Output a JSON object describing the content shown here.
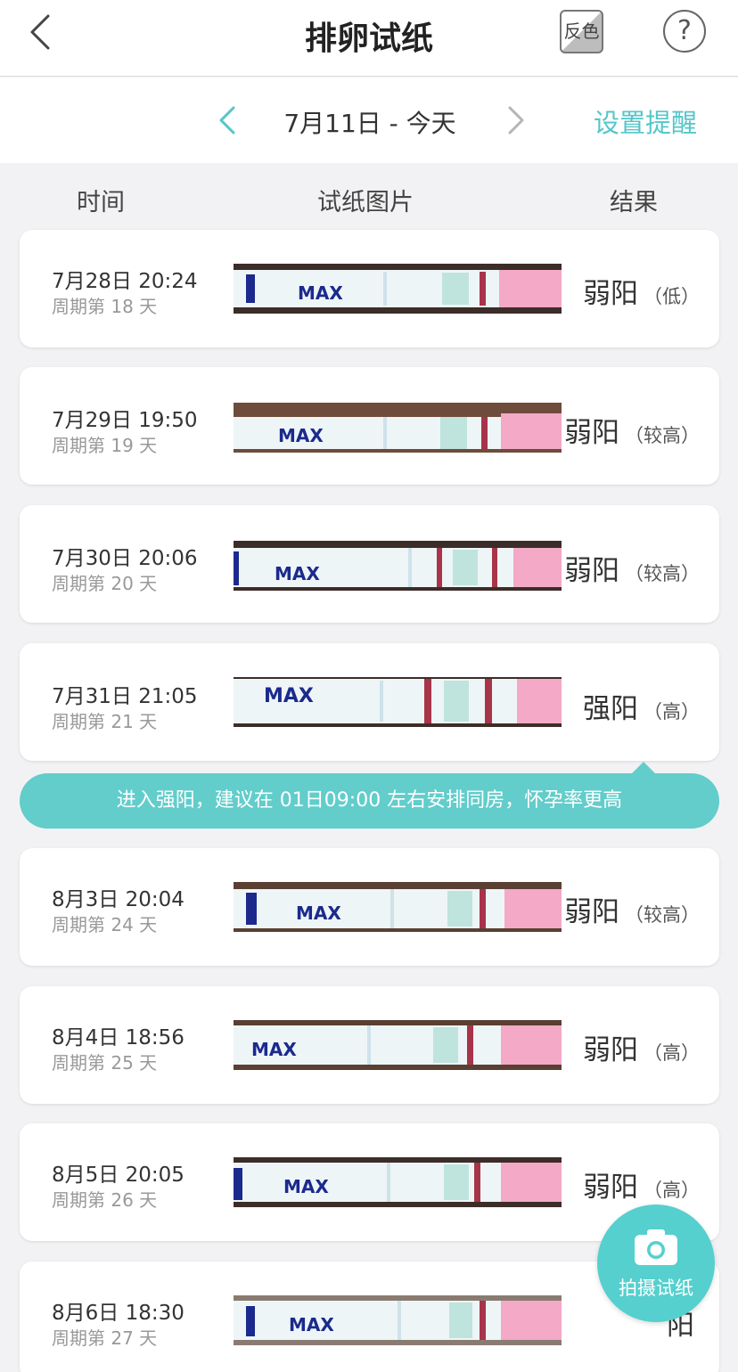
{
  "nav": {
    "title": "排卵试纸",
    "invert_label": "反色",
    "help_label": "?"
  },
  "date_bar": {
    "range": "7月11日 - 今天",
    "reminder": "设置提醒"
  },
  "columns": {
    "time": "时间",
    "picture": "试纸图片",
    "result": "结果"
  },
  "records": [
    {
      "datetime": "7月28日 20:24",
      "cycle": "周期第 18 天",
      "result": "弱阳",
      "level": "（低）",
      "strip_label": "MAX"
    },
    {
      "datetime": "7月29日 19:50",
      "cycle": "周期第 19 天",
      "result": "弱阳",
      "level": "（较高）",
      "strip_label": "MAX"
    },
    {
      "datetime": "7月30日 20:06",
      "cycle": "周期第 20 天",
      "result": "弱阳",
      "level": "（较高）",
      "strip_label": "MAX"
    },
    {
      "datetime": "7月31日 21:05",
      "cycle": "周期第 21 天",
      "result": "强阳",
      "level": "（高）",
      "strip_label": "MAX"
    },
    {
      "datetime": "8月3日 20:04",
      "cycle": "周期第 24 天",
      "result": "弱阳",
      "level": "（较高）",
      "strip_label": "MAX"
    },
    {
      "datetime": "8月4日 18:56",
      "cycle": "周期第 25 天",
      "result": "弱阳",
      "level": "（高）",
      "strip_label": "MAX"
    },
    {
      "datetime": "8月5日 20:05",
      "cycle": "周期第 26 天",
      "result": "弱阳",
      "level": "（高）",
      "strip_label": "MAX"
    },
    {
      "datetime": "8月6日 18:30",
      "cycle": "周期第 27 天",
      "result": "阳",
      "level": "",
      "strip_label": "MAX"
    }
  ],
  "tip": "进入强阳，建议在 01日09:00 左右安排同房，怀孕率更高",
  "fab": {
    "label": "拍摄试纸",
    "icon": "camera-icon"
  },
  "colors": {
    "accent": "#55c6c8",
    "tip_bg": "#62cdcb",
    "fab_bg": "#55d0ce",
    "strip_pink": "#f4a9c7",
    "strip_line": "#a8344a",
    "strip_blue": "#1b2a8c"
  }
}
